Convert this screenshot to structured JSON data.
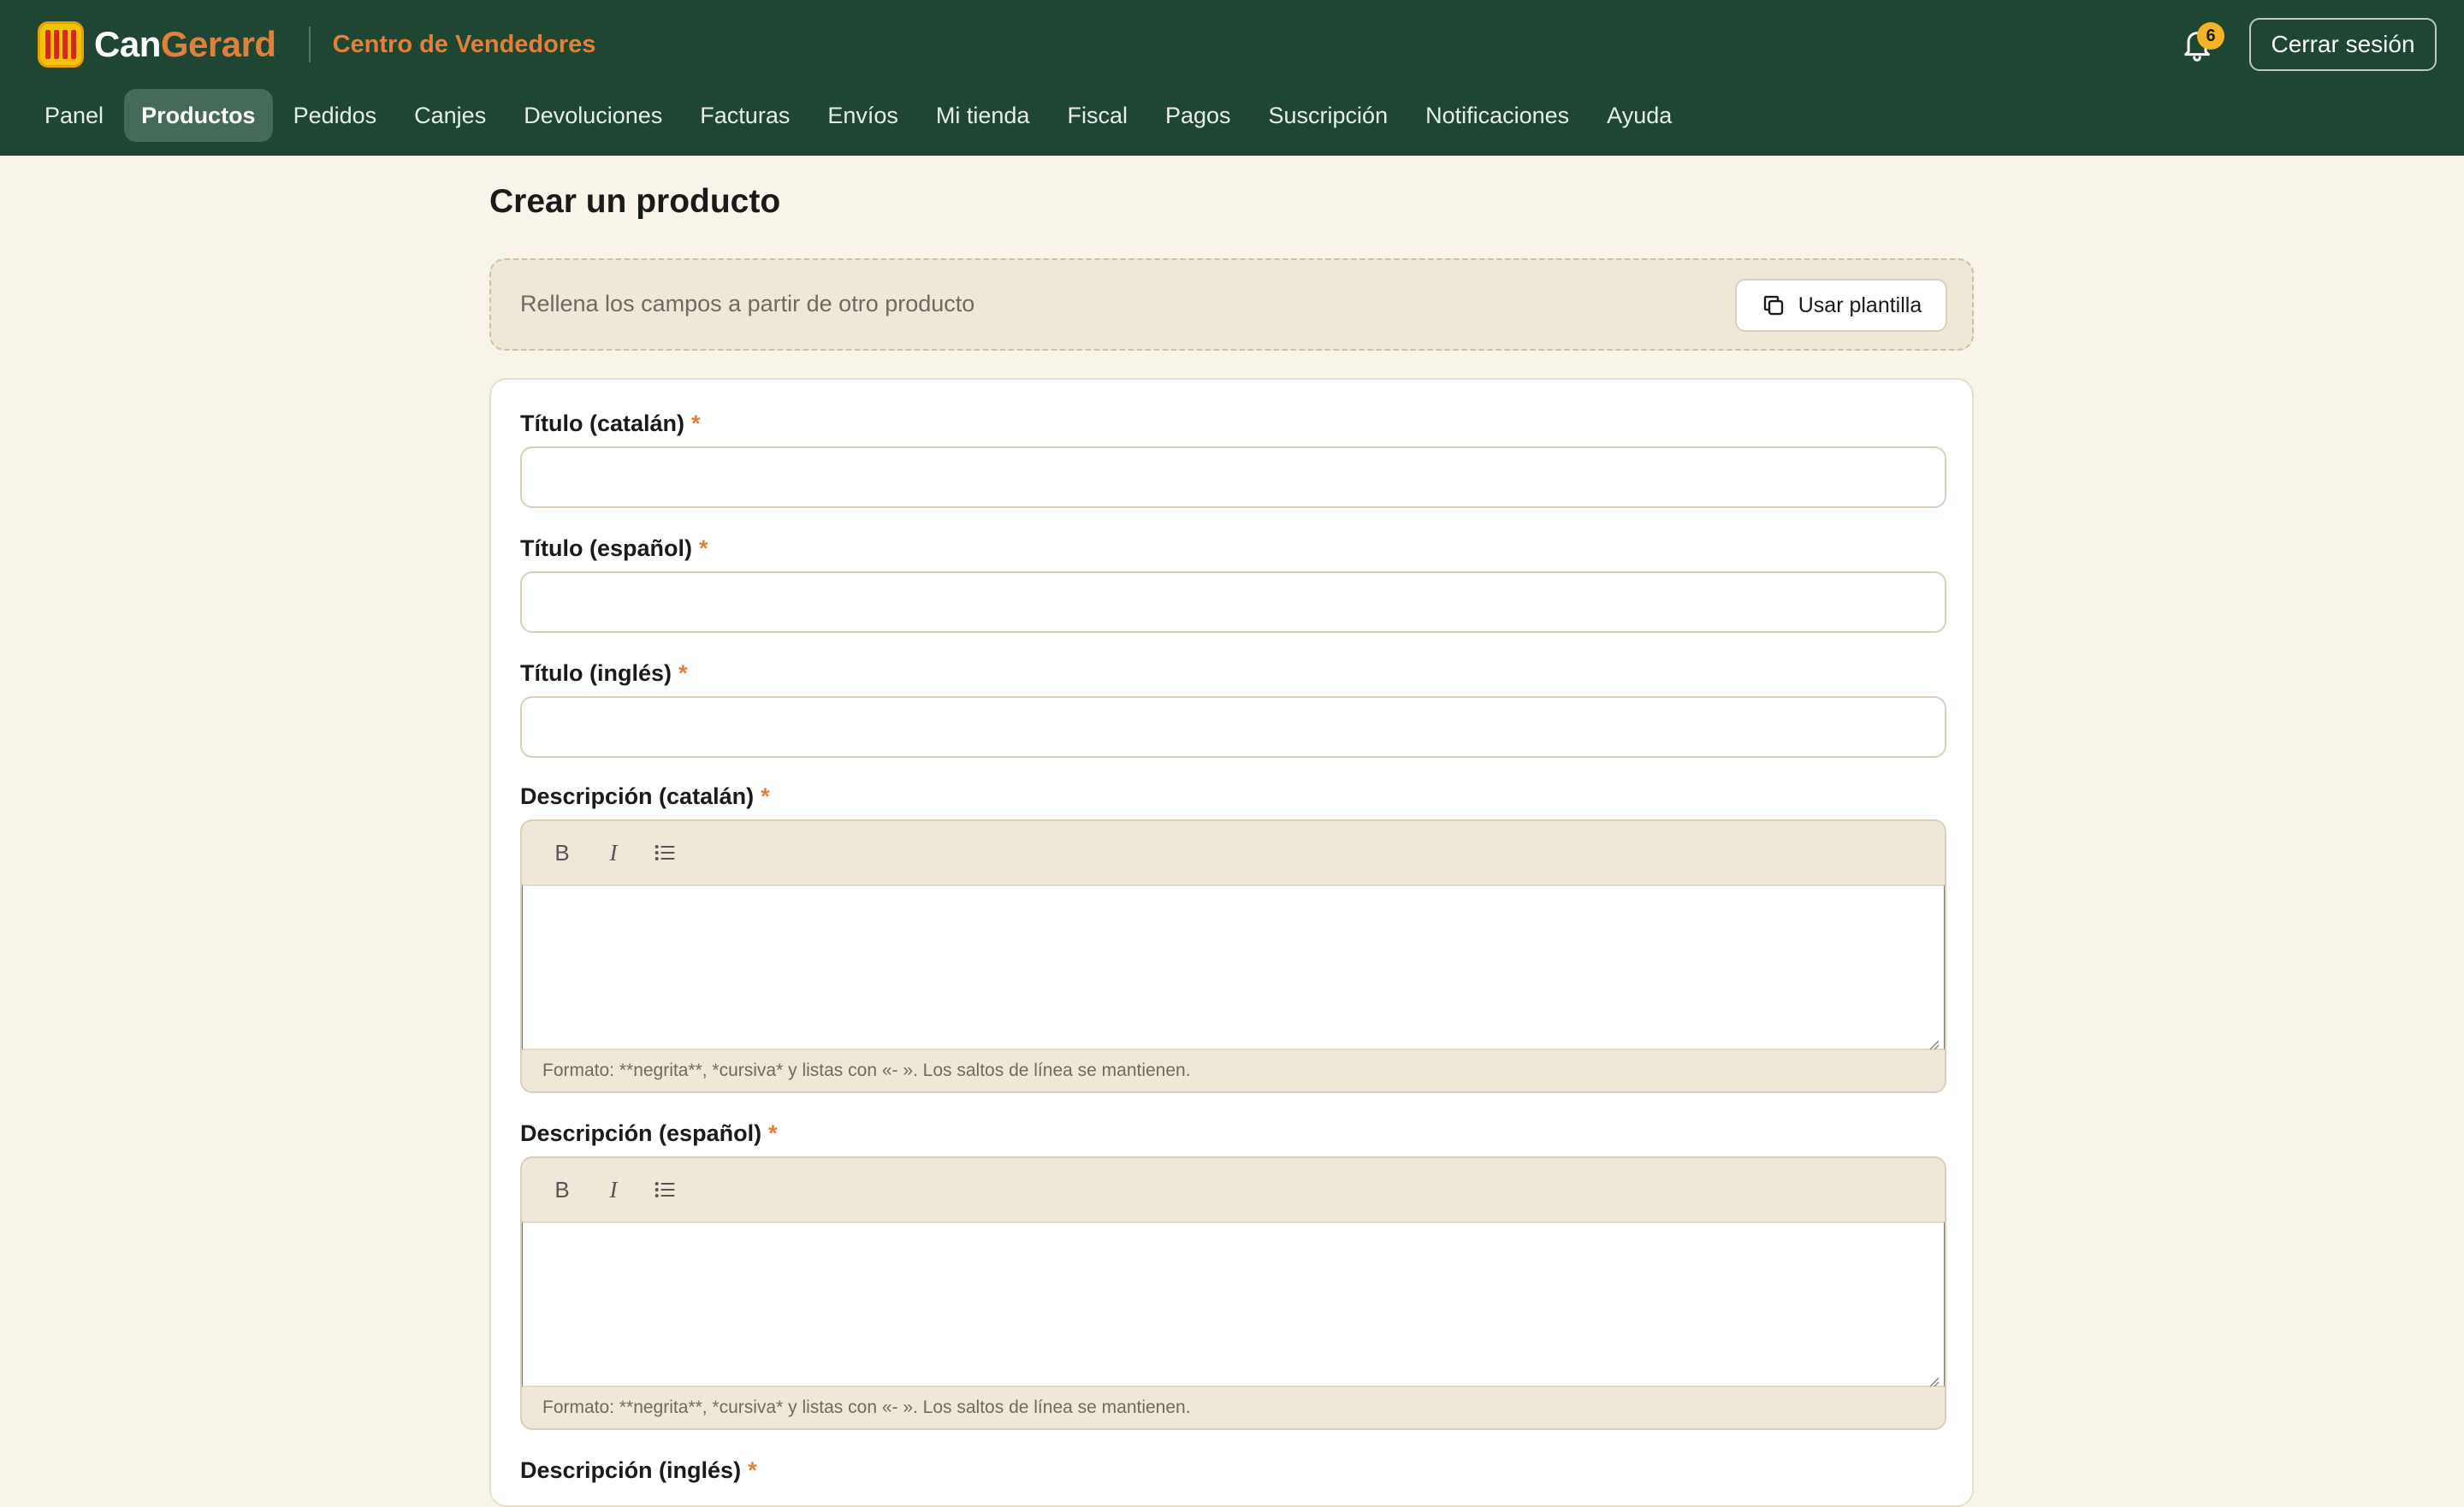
{
  "header": {
    "brand_part1": "Can",
    "brand_part2": "Gerard",
    "subtitle": "Centro de Vendedores",
    "notifications_count": "6",
    "logout_label": "Cerrar sesión"
  },
  "nav": {
    "items": [
      {
        "label": "Panel",
        "active": false
      },
      {
        "label": "Productos",
        "active": true
      },
      {
        "label": "Pedidos",
        "active": false
      },
      {
        "label": "Canjes",
        "active": false
      },
      {
        "label": "Devoluciones",
        "active": false
      },
      {
        "label": "Facturas",
        "active": false
      },
      {
        "label": "Envíos",
        "active": false
      },
      {
        "label": "Mi tienda",
        "active": false
      },
      {
        "label": "Fiscal",
        "active": false
      },
      {
        "label": "Pagos",
        "active": false
      },
      {
        "label": "Suscripción",
        "active": false
      },
      {
        "label": "Notificaciones",
        "active": false
      },
      {
        "label": "Ayuda",
        "active": false
      }
    ]
  },
  "page": {
    "title": "Crear un producto",
    "template_hint": "Rellena los campos a partir de otro producto",
    "template_button": "Usar plantilla"
  },
  "form": {
    "required_mark": "*",
    "title_ca": {
      "label": "Título (catalán)",
      "value": ""
    },
    "title_es": {
      "label": "Título (español)",
      "value": ""
    },
    "title_en": {
      "label": "Título (inglés)",
      "value": ""
    },
    "desc_ca": {
      "label": "Descripción (catalán)",
      "value": ""
    },
    "desc_es": {
      "label": "Descripción (español)",
      "value": ""
    },
    "desc_en": {
      "label": "Descripción (inglés)"
    },
    "format_hint": "Formato: **negrita**, *cursiva* y listas con «- ». Los saltos de línea se mantienen.",
    "toolbar": {
      "bold": "B",
      "italic": "I"
    }
  },
  "colors": {
    "header_bg": "#1e4632",
    "accent": "#e0803a",
    "page_bg": "#f8f4ea",
    "badge": "#f5b427"
  },
  "icons": [
    "bell-icon",
    "copy-icon",
    "bold-icon",
    "italic-icon",
    "list-icon",
    "resize-grip-icon"
  ]
}
